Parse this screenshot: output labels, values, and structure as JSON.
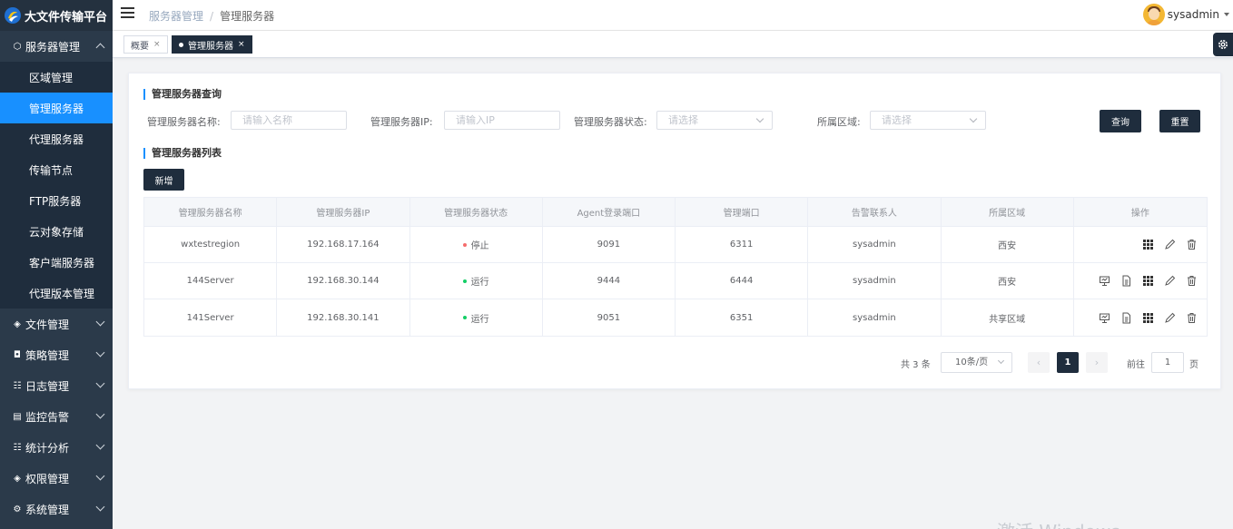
{
  "app": {
    "title": "大文件传输平台"
  },
  "sidebar": {
    "groups": [
      {
        "label": "服务器管理",
        "icon": "cube-icon",
        "expanded": true,
        "items": [
          {
            "label": "区域管理"
          },
          {
            "label": "管理服务器",
            "active": true
          },
          {
            "label": "代理服务器"
          },
          {
            "label": "传输节点"
          },
          {
            "label": "FTP服务器"
          },
          {
            "label": "云对象存储"
          },
          {
            "label": "客户端服务器"
          },
          {
            "label": "代理版本管理"
          }
        ]
      },
      {
        "label": "文件管理",
        "icon": "layers-icon"
      },
      {
        "label": "策略管理",
        "icon": "policy-icon"
      },
      {
        "label": "日志管理",
        "icon": "log-icon"
      },
      {
        "label": "监控告警",
        "icon": "monitor-icon"
      },
      {
        "label": "统计分析",
        "icon": "stats-icon"
      },
      {
        "label": "权限管理",
        "icon": "layers-icon"
      },
      {
        "label": "系统管理",
        "icon": "gear-icon"
      }
    ]
  },
  "header": {
    "breadcrumb": [
      "服务器管理",
      "管理服务器"
    ],
    "username": "sysadmin"
  },
  "tabs": [
    {
      "label": "概要",
      "close": "×"
    },
    {
      "label": "管理服务器",
      "close": "×",
      "active": true
    }
  ],
  "query": {
    "title": "管理服务器查询",
    "fields": [
      {
        "label": "管理服务器名称:",
        "placeholder": "请输入名称"
      },
      {
        "label": "管理服务器IP:",
        "placeholder": "请输入IP"
      },
      {
        "label": "管理服务器状态:",
        "placeholder": "请选择"
      },
      {
        "label": "所属区域:",
        "placeholder": "请选择"
      }
    ],
    "search_label": "查询",
    "reset_label": "重置"
  },
  "list": {
    "title": "管理服务器列表",
    "add_label": "新增",
    "columns": [
      "管理服务器名称",
      "管理服务器IP",
      "管理服务器状态",
      "Agent登录端口",
      "管理端口",
      "告警联系人",
      "所属区域",
      "操作"
    ],
    "rows": [
      {
        "name": "wxtestregion",
        "ip": "192.168.17.164",
        "status": "停止",
        "status_color": "#f56c6c",
        "agent_port": "9091",
        "mgmt_port": "6311",
        "contact": "sysadmin",
        "region": "西安",
        "ops": [
          "grid-icon",
          "edit-icon",
          "delete-icon"
        ]
      },
      {
        "name": "144Server",
        "ip": "192.168.30.144",
        "status": "运行",
        "status_color": "#13ce66",
        "agent_port": "9444",
        "mgmt_port": "6444",
        "contact": "sysadmin",
        "region": "西安",
        "ops": [
          "monitor-icon",
          "document-icon",
          "grid-icon",
          "edit-icon",
          "delete-icon"
        ]
      },
      {
        "name": "141Server",
        "ip": "192.168.30.141",
        "status": "运行",
        "status_color": "#13ce66",
        "agent_port": "9051",
        "mgmt_port": "6351",
        "contact": "sysadmin",
        "region": "共享区域",
        "ops": [
          "monitor-icon",
          "document-icon",
          "grid-icon",
          "edit-icon",
          "delete-icon"
        ]
      }
    ]
  },
  "pagination": {
    "total": "共 3 条",
    "page_size": "10条/页",
    "current_page": "1",
    "goto_prefix": "前往",
    "goto_value": "1",
    "goto_suffix": "页"
  },
  "watermark": "激活 Windows"
}
